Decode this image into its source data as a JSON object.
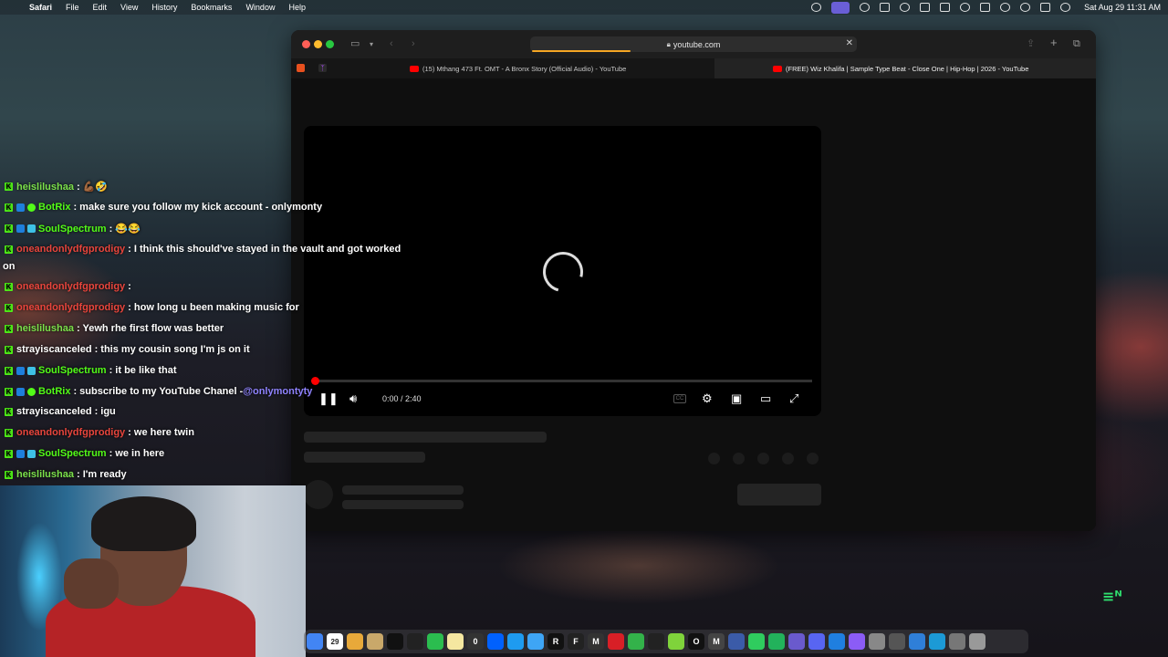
{
  "menubar": {
    "app": "Safari",
    "items": [
      "File",
      "Edit",
      "View",
      "History",
      "Bookmarks",
      "Window",
      "Help"
    ],
    "clock": "Sat Aug 29  11:31 AM"
  },
  "browser": {
    "url": "youtube.com",
    "tabs": [
      {
        "label": "(15) Mthang 473 Ft. OMT - A Bronx Story (Official Audio) - YouTube",
        "active": false
      },
      {
        "label": "(FREE) Wiz Khalifa | Sample Type Beat - Close One | Hip-Hop | 2026 - YouTube",
        "active": true
      }
    ],
    "player": {
      "time": "0:00 / 2:40",
      "cc_label": "CC",
      "progress": 0.0
    }
  },
  "chat": {
    "messages": [
      {
        "user": "heislilushaa",
        "color": "#7be04a",
        "text": ": 💪🏾🤣",
        "badges": []
      },
      {
        "user": "BotRix",
        "color": "#53fc18",
        "text": ": make sure you follow my kick account - onlymonty",
        "badges": [
          "b",
          "g"
        ]
      },
      {
        "user": "SoulSpectrum",
        "color": "#53fc18",
        "text": ": 😂😂",
        "badges": [
          "b",
          "c"
        ]
      },
      {
        "user": "oneandonlydfgprodigy",
        "color": "#e8453c",
        "text": ": I think this should've stayed in the vault and got worked",
        "badges": []
      },
      {
        "user": "",
        "color": "#ffffff",
        "text": "on",
        "badges": []
      },
      {
        "user": "oneandonlydfgprodigy",
        "color": "#e8453c",
        "text": ":",
        "badges": []
      },
      {
        "user": "oneandonlydfgprodigy",
        "color": "#e8453c",
        "text": ": how long u been making music for",
        "badges": []
      },
      {
        "user": "heislilushaa",
        "color": "#7be04a",
        "text": ": Yewh rhe first flow was better",
        "badges": []
      },
      {
        "user": "strayiscanceled",
        "color": "#ffffff",
        "text": ": this my cousin song I'm js on it",
        "badges": []
      },
      {
        "user": "SoulSpectrum",
        "color": "#53fc18",
        "text": ": it be like that",
        "badges": [
          "b",
          "c"
        ]
      },
      {
        "user": "BotRix",
        "color": "#53fc18",
        "text": ": subscribe to my YouTube Chanel - ",
        "mention": "@onlymontyty",
        "badges": [
          "b",
          "g"
        ]
      },
      {
        "user": "strayiscanceled",
        "color": "#ffffff",
        "text": ": igu",
        "badges": []
      },
      {
        "user": "oneandonlydfgprodigy",
        "color": "#e8453c",
        "text": ": we here twin",
        "badges": []
      },
      {
        "user": "SoulSpectrum",
        "color": "#53fc18",
        "text": ": we in here",
        "badges": [
          "b",
          "c"
        ]
      },
      {
        "user": "heislilushaa",
        "color": "#7be04a",
        "text": ": I'm ready",
        "badges": []
      }
    ]
  },
  "dock": {
    "icons": [
      "chrome-icon",
      "calendar-icon",
      "photos-icon",
      "notes-icon",
      "appletv-icon",
      "capcut-icon",
      "numbers-icon",
      "notes2-icon",
      "0",
      "dropbox-icon",
      "appstore-icon",
      "finder-icon",
      "R",
      "F",
      "M",
      "red-icon",
      "green-icon",
      "brush-icon",
      "x-icon",
      "O",
      "M",
      "screen-icon",
      "wa-icon",
      "grid-icon",
      "purple-icon",
      "discord-icon",
      "bluetooth-icon",
      "cursor-icon",
      "settings-icon",
      "help-icon",
      "globe-icon",
      "globe2-icon",
      "question-icon",
      "trash-icon"
    ],
    "icon_colors": [
      "#4285f4",
      "#ffffff",
      "#e8a93a",
      "#c9a86a",
      "#111111",
      "#222222",
      "#2bbd4f",
      "#f5e7a0",
      "#333333",
      "#0061fe",
      "#1e9bf0",
      "#3ea5f5",
      "#111111",
      "#222222",
      "#333333",
      "#d81f26",
      "#33b24a",
      "#222222",
      "#7fd33b",
      "#111111",
      "#444444",
      "#3b5ba8",
      "#2fcc5e",
      "#22b25b",
      "#6a5acd",
      "#5865f2",
      "#1f7fe0",
      "#8b5cf6",
      "#888888",
      "#555555",
      "#2f7fd8",
      "#1c9ad6",
      "#777777",
      "#999999"
    ],
    "calendar_day": "29"
  }
}
